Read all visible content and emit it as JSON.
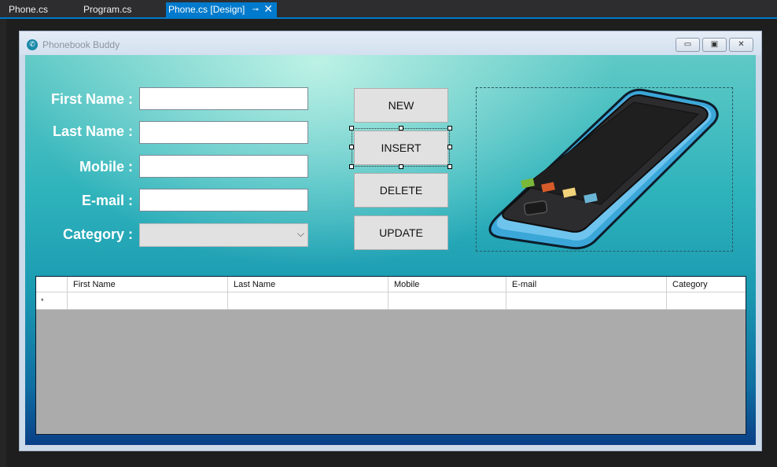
{
  "tabs": [
    {
      "label": "Phone.cs",
      "active": false
    },
    {
      "label": "Program.cs",
      "active": false
    },
    {
      "label": "Phone.cs [Design]",
      "active": true
    }
  ],
  "window": {
    "title": "Phonebook Buddy",
    "minimize_glyph": "▭",
    "maximize_glyph": "▣",
    "close_glyph": "✕",
    "icon": "phone-app-icon"
  },
  "form": {
    "labels": {
      "first_name": "First Name :",
      "last_name": "Last Name :",
      "mobile": "Mobile :",
      "email": "E-mail :",
      "category": "Category :"
    },
    "values": {
      "first_name": "",
      "last_name": "",
      "mobile": "",
      "email": "",
      "category": ""
    },
    "buttons": {
      "new": "NEW",
      "insert": "INSERT",
      "delete": "DELETE",
      "update": "UPDATE"
    },
    "picture": "smartphone-illustration"
  },
  "grid": {
    "columns": [
      "First Name",
      "Last Name",
      "Mobile",
      "E-mail",
      "Category"
    ],
    "new_row_marker": "*",
    "rows": []
  },
  "colors": {
    "ide_accent": "#007acc",
    "ide_background": "#2d2d30",
    "form_gradient_top": "#5fc9c6",
    "form_gradient_bottom": "#0a3f87",
    "grid_empty": "#ababab",
    "button_face": "#e1e1e1"
  }
}
